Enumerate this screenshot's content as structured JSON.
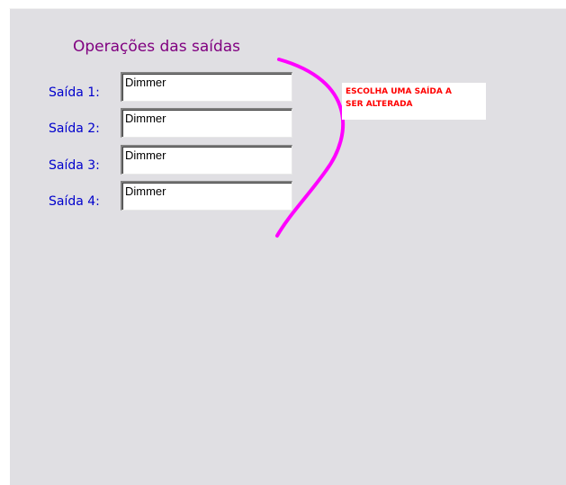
{
  "group": {
    "title": "Operações das saídas"
  },
  "outputs": [
    {
      "label": "Saída 1:",
      "value": "Dimmer"
    },
    {
      "label": "Saída 2:",
      "value": "Dimmer"
    },
    {
      "label": "Saída 3:",
      "value": "Dimmer"
    },
    {
      "label": "Saída 4:",
      "value": "Dimmer"
    }
  ],
  "annotation": {
    "line1": "ESCOLHA UMA SAÍDA A",
    "line2": "SER ALTERADA",
    "text_color": "#ff0000",
    "curve_color": "#ff00ff"
  },
  "colors": {
    "panel_bg": "#e0dfe3",
    "title": "#800080",
    "labels": "#0000cc"
  }
}
